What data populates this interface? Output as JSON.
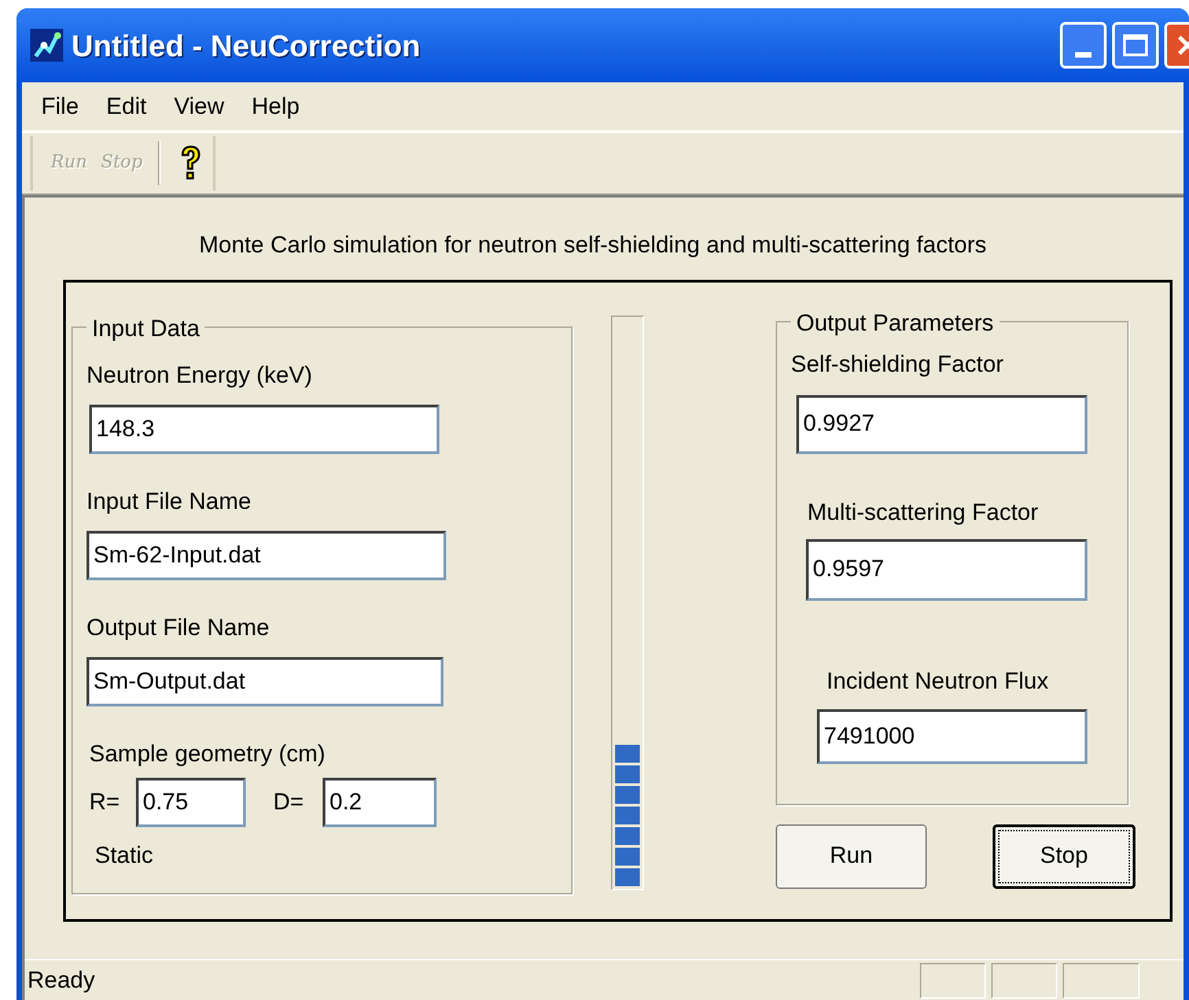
{
  "window": {
    "title": "Untitled - NeuCorrection"
  },
  "menu": [
    {
      "label": "File"
    },
    {
      "label": "Edit"
    },
    {
      "label": "View"
    },
    {
      "label": "Help"
    }
  ],
  "toolbar": [
    {
      "kind": "text",
      "label": "Run",
      "disabled": true
    },
    {
      "kind": "text",
      "label": "Stop",
      "disabled": true
    },
    {
      "kind": "help",
      "disabled": false
    }
  ],
  "heading": "Monte Carlo simulation for neutron self-shielding and multi-scattering factors",
  "input_data": {
    "title": "Input Data",
    "fields": [
      {
        "label": "Neutron Energy (keV)",
        "value": "148.3"
      },
      {
        "label": "Input File Name",
        "value": "Sm-62-Input.dat"
      },
      {
        "label": "Output File Name",
        "value": "Sm-Output.dat"
      }
    ],
    "geometry": {
      "label": "Sample geometry (cm)",
      "r_label": "R=",
      "r_value": "0.75",
      "d_label": "D=",
      "d_value": "0.2"
    },
    "static": "Static"
  },
  "progress": {
    "level": 0.25
  },
  "output_parameters": {
    "title": "Output Parameters",
    "fields": [
      {
        "label": "Self-shielding Factor",
        "value": "0.9927"
      },
      {
        "label": "Multi-scattering Factor",
        "value": "0.9597"
      },
      {
        "label": "Incident Neutron Flux",
        "value": "7491000"
      }
    ]
  },
  "buttons": [
    {
      "label": "Run",
      "focused": false
    },
    {
      "label": "Stop",
      "focused": true
    }
  ],
  "status_bar": {
    "text": "Ready"
  }
}
